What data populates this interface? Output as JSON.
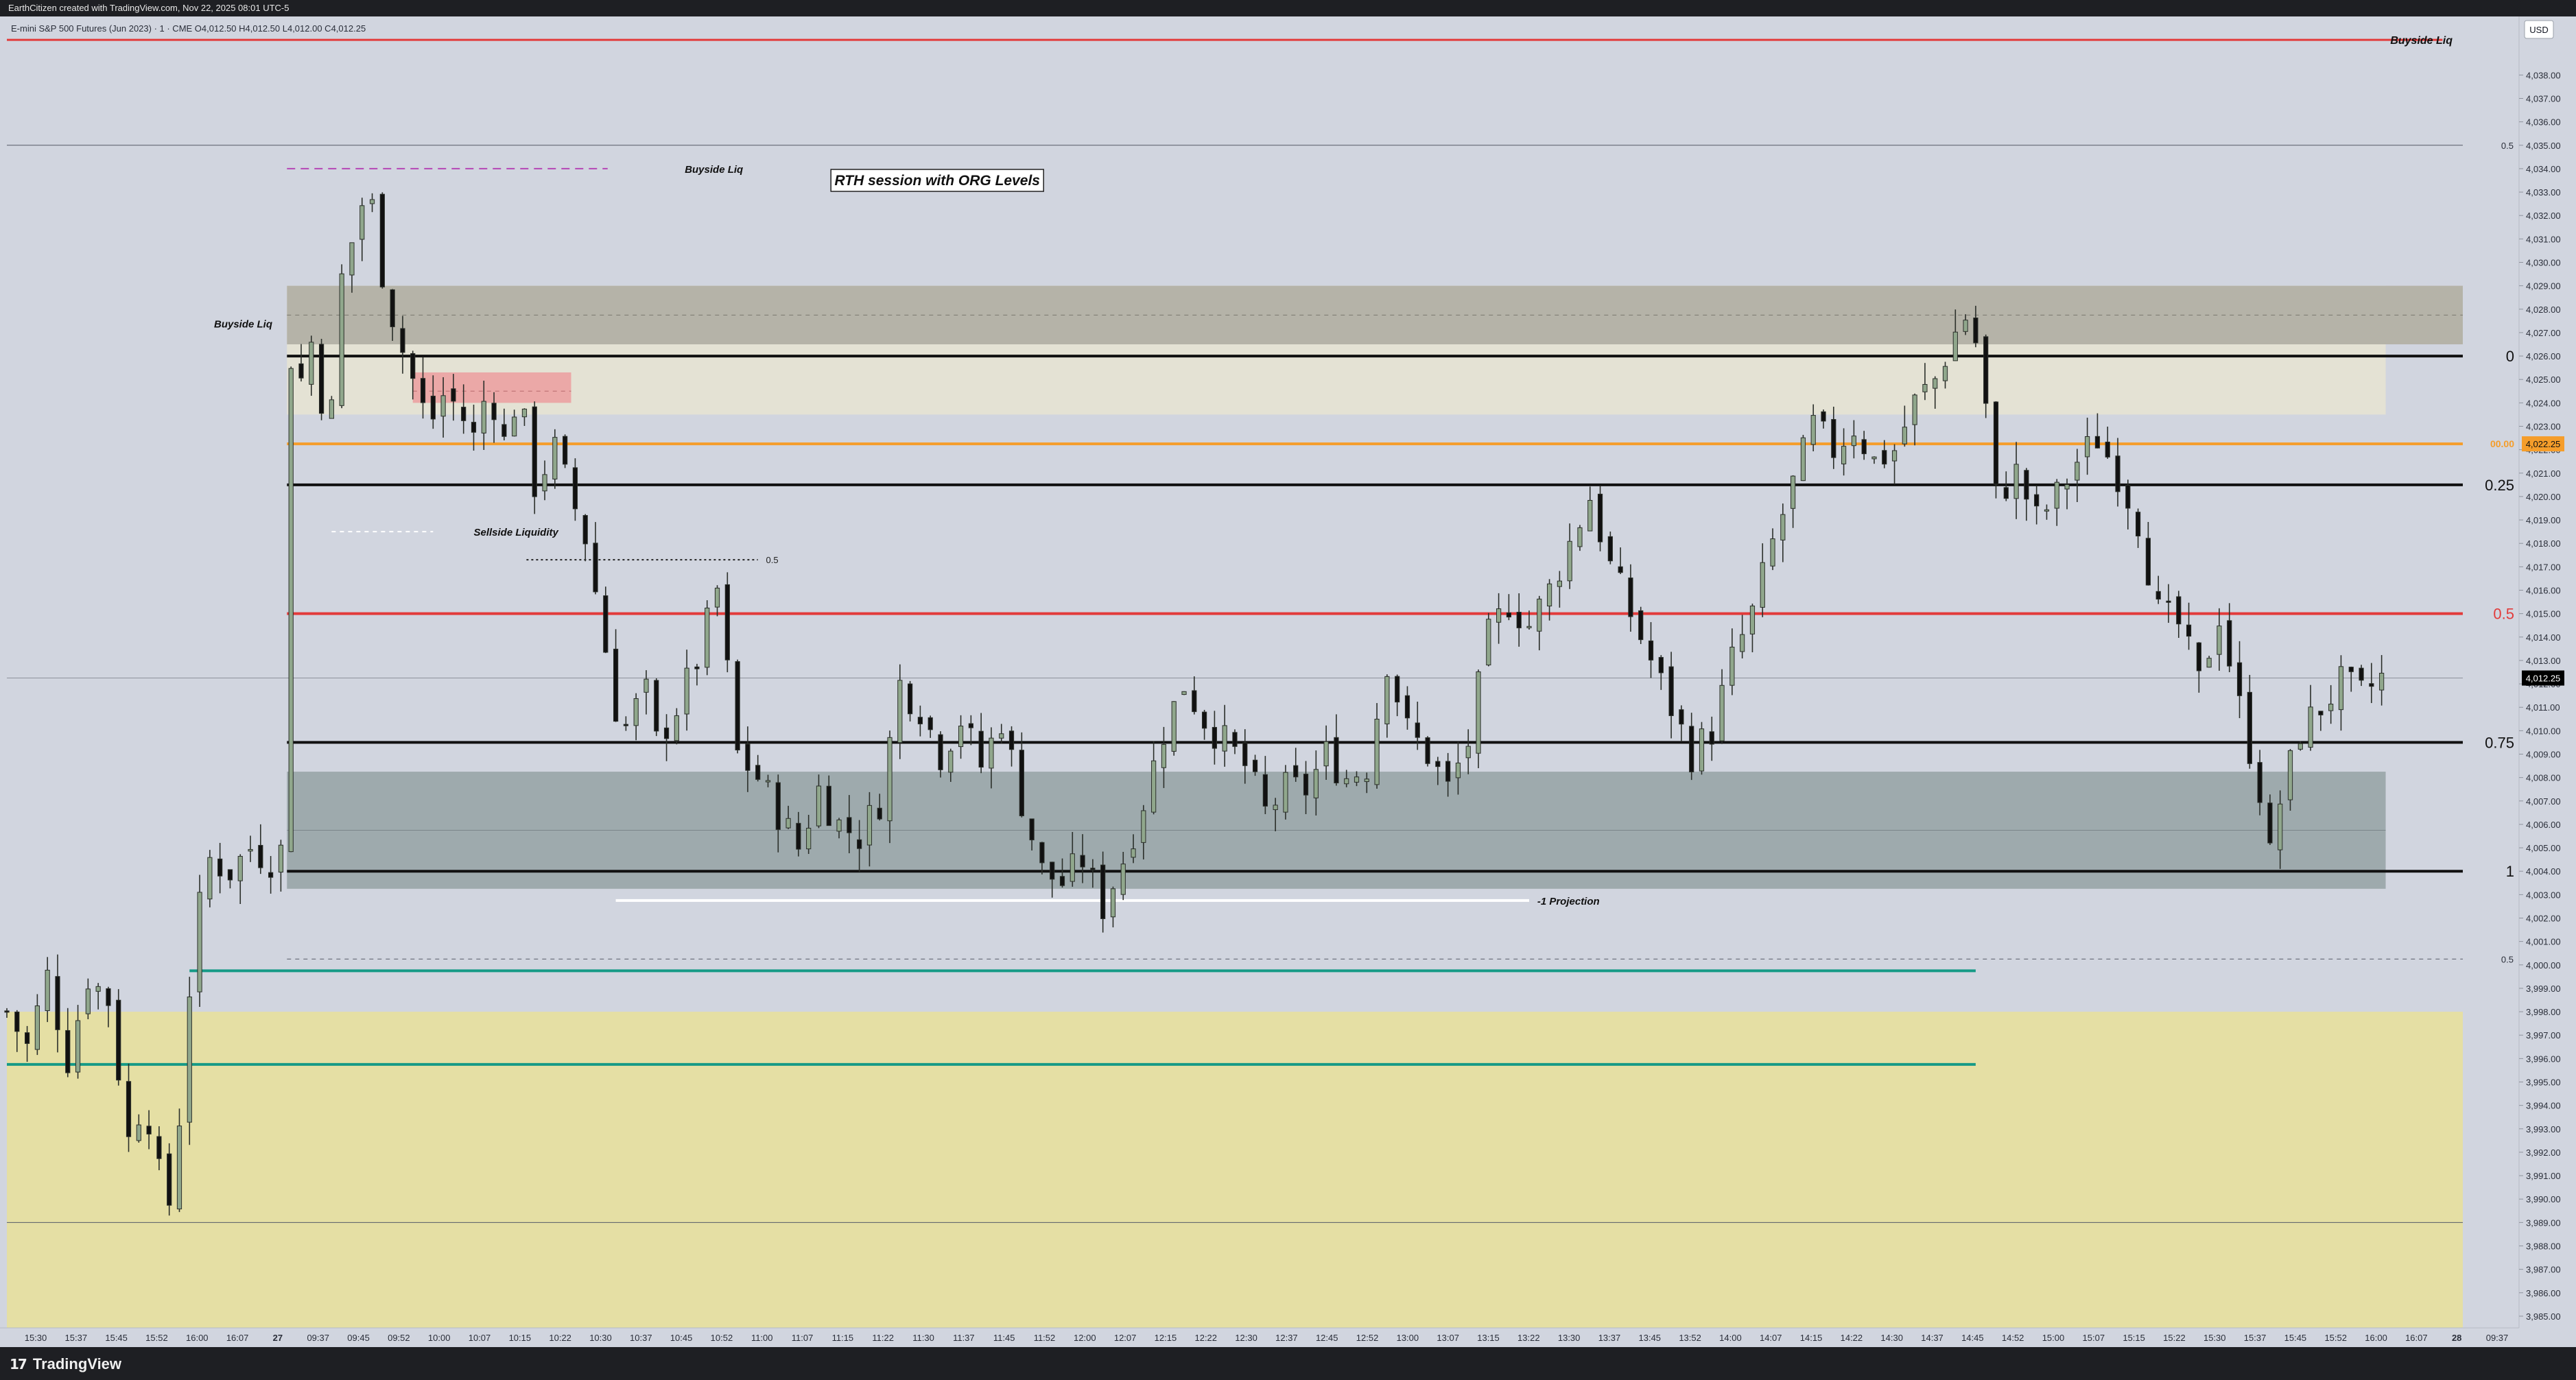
{
  "header": {
    "caption": "EarthCitizen created with TradingView.com, Nov 22, 2025 08:01 UTC-5"
  },
  "footer": {
    "brand": "TradingView",
    "brand_icon": "tradingview-logo-icon"
  },
  "chart_data": {
    "type": "candlestick",
    "symbol_line": "E-mini S&P 500 Futures (Jun 2023) · 1 · CME  O4,012.50  H4,012.50  L4,012.00  C4,012.25",
    "currency": "USD",
    "ylim": [
      3984.5,
      4040.5
    ],
    "y_ticks": [
      "4,038.00",
      "4,037.00",
      "4,036.00",
      "4,035.00",
      "4,034.00",
      "4,033.00",
      "4,032.00",
      "4,031.00",
      "4,030.00",
      "4,029.00",
      "4,028.00",
      "4,027.00",
      "4,026.00",
      "4,025.00",
      "4,024.00",
      "4,023.00",
      "4,022.00",
      "4,021.00",
      "4,020.00",
      "4,019.00",
      "4,018.00",
      "4,017.00",
      "4,016.00",
      "4,015.00",
      "4,014.00",
      "4,013.00",
      "4,012.00",
      "4,011.00",
      "4,010.00",
      "4,009.00",
      "4,008.00",
      "4,007.00",
      "4,006.00",
      "4,005.00",
      "4,004.00",
      "4,003.00",
      "4,002.00",
      "4,001.00",
      "4,000.00",
      "3,999.00",
      "3,998.00",
      "3,997.00",
      "3,996.00",
      "3,995.00",
      "3,994.00",
      "3,993.00",
      "3,992.00",
      "3,991.00",
      "3,990.00",
      "3,989.00",
      "3,988.00",
      "3,987.00",
      "3,986.00",
      "3,985.00"
    ],
    "x_ticks": [
      "15:30",
      "15:37",
      "15:45",
      "15:52",
      "16:00",
      "16:07",
      "27",
      "09:37",
      "09:45",
      "09:52",
      "10:00",
      "10:07",
      "10:15",
      "10:22",
      "10:30",
      "10:37",
      "10:45",
      "10:52",
      "11:00",
      "11:07",
      "11:15",
      "11:22",
      "11:30",
      "11:37",
      "11:45",
      "11:52",
      "12:00",
      "12:07",
      "12:15",
      "12:22",
      "12:30",
      "12:37",
      "12:45",
      "12:52",
      "13:00",
      "13:07",
      "13:15",
      "13:22",
      "13:30",
      "13:37",
      "13:45",
      "13:52",
      "14:00",
      "14:07",
      "14:15",
      "14:22",
      "14:30",
      "14:37",
      "14:45",
      "14:52",
      "15:00",
      "15:07",
      "15:15",
      "15:22",
      "15:30",
      "15:37",
      "15:45",
      "15:52",
      "16:00",
      "16:07",
      "28",
      "09:37"
    ],
    "x_range": [
      0,
      60.5
    ],
    "price_path": [
      [
        0,
        3998
      ],
      [
        0.5,
        3996.5
      ],
      [
        1,
        3999.5
      ],
      [
        1.5,
        3996
      ],
      [
        2,
        3999.5
      ],
      [
        2.5,
        3998.5
      ],
      [
        3,
        3992.5
      ],
      [
        3.4,
        3994.5
      ],
      [
        3.8,
        3990.5
      ],
      [
        4.1,
        3989.5
      ],
      [
        4.4,
        3997.5
      ],
      [
        4.7,
        4002
      ],
      [
        5,
        4004.5
      ],
      [
        5.5,
        4004
      ],
      [
        6,
        4005
      ],
      [
        6.5,
        4004.5
      ],
      [
        6.85,
        4005
      ],
      [
        7,
        4026
      ],
      [
        7.3,
        4024.8
      ],
      [
        7.6,
        4027.5
      ],
      [
        7.9,
        4021
      ],
      [
        8.2,
        4029
      ],
      [
        8.6,
        4031.5
      ],
      [
        8.9,
        4033.5
      ],
      [
        9.2,
        4030
      ],
      [
        9.6,
        4027
      ],
      [
        10,
        4025
      ],
      [
        10.4,
        4023
      ],
      [
        10.8,
        4024.5
      ],
      [
        11.2,
        4023.5
      ],
      [
        11.5,
        4022.5
      ],
      [
        11.9,
        4025
      ],
      [
        12.2,
        4022
      ],
      [
        12.6,
        4024.5
      ],
      [
        13,
        4020.5
      ],
      [
        13.5,
        4022
      ],
      [
        13.9,
        4020
      ],
      [
        14.3,
        4018
      ],
      [
        14.6,
        4015
      ],
      [
        15,
        4011
      ],
      [
        15.3,
        4010
      ],
      [
        15.7,
        4012
      ],
      [
        16,
        4009.5
      ],
      [
        16.5,
        4011
      ],
      [
        17,
        4013
      ],
      [
        17.5,
        4016
      ],
      [
        18,
        4009
      ],
      [
        18.5,
        4008
      ],
      [
        19,
        4006.5
      ],
      [
        19.5,
        4005
      ],
      [
        20,
        4007.5
      ],
      [
        20.5,
        4006
      ],
      [
        21,
        4005.5
      ],
      [
        21.5,
        4007
      ],
      [
        22,
        4012
      ],
      [
        22.5,
        4011
      ],
      [
        23,
        4009
      ],
      [
        23.5,
        4010.5
      ],
      [
        24,
        4008.5
      ],
      [
        24.5,
        4010.5
      ],
      [
        25,
        4007
      ],
      [
        25.5,
        4004
      ],
      [
        26,
        4003.5
      ],
      [
        26.5,
        4004.5
      ],
      [
        27,
        4002.5
      ],
      [
        27.5,
        4004.5
      ],
      [
        28,
        4007
      ],
      [
        28.5,
        4010
      ],
      [
        29,
        4012
      ],
      [
        29.5,
        4010.5
      ],
      [
        30,
        4009.5
      ],
      [
        30.5,
        4008.5
      ],
      [
        31,
        4006.5
      ],
      [
        31.5,
        4007.5
      ],
      [
        32,
        4007.5
      ],
      [
        32.5,
        4009
      ],
      [
        33,
        4008
      ],
      [
        33.5,
        4008.5
      ],
      [
        34,
        4013
      ],
      [
        34.5,
        4010
      ],
      [
        35,
        4009
      ],
      [
        35.5,
        4007.5
      ],
      [
        36,
        4009.5
      ],
      [
        36.5,
        4014
      ],
      [
        37,
        4015.5
      ],
      [
        37.5,
        4014.5
      ],
      [
        38,
        4016
      ],
      [
        38.5,
        4018
      ],
      [
        39,
        4020
      ],
      [
        39.5,
        4017
      ],
      [
        40,
        4015
      ],
      [
        40.5,
        4013
      ],
      [
        41,
        4011
      ],
      [
        41.5,
        4009
      ],
      [
        42,
        4010
      ],
      [
        42.5,
        4013
      ],
      [
        43,
        4015
      ],
      [
        43.5,
        4018
      ],
      [
        44,
        4020.5
      ],
      [
        44.5,
        4023
      ],
      [
        45,
        4022
      ],
      [
        45.5,
        4023
      ],
      [
        46,
        4021.5
      ],
      [
        46.5,
        4022
      ],
      [
        47,
        4024
      ],
      [
        47.5,
        4025
      ],
      [
        48,
        4027
      ],
      [
        48.3,
        4027.8
      ],
      [
        48.6,
        4026
      ],
      [
        49,
        4020
      ],
      [
        49.5,
        4021
      ],
      [
        50,
        4019
      ],
      [
        50.5,
        4020
      ],
      [
        51,
        4021.5
      ],
      [
        51.5,
        4022.5
      ],
      [
        52,
        4021
      ],
      [
        52.5,
        4019
      ],
      [
        53,
        4015
      ],
      [
        53.5,
        4014.5
      ],
      [
        54,
        4012
      ],
      [
        54.5,
        4015
      ],
      [
        55,
        4011
      ],
      [
        55.5,
        4007.5
      ],
      [
        55.8,
        4004
      ],
      [
        56,
        4007
      ],
      [
        56.5,
        4010
      ],
      [
        57,
        4011
      ],
      [
        57.5,
        4012
      ],
      [
        58,
        4011.5
      ],
      [
        58.5,
        4012.25
      ]
    ],
    "levels": [
      {
        "price": 4026.0,
        "label": "0",
        "color": "#111111"
      },
      {
        "price": 4022.25,
        "label": "00.00",
        "color": "#f59d2a"
      },
      {
        "price": 4020.5,
        "label": "0.25",
        "color": "#111111"
      },
      {
        "price": 4015.0,
        "label": "0.5",
        "color": "#e23b3b"
      },
      {
        "price": 4009.5,
        "label": "0.75",
        "color": "#111111"
      },
      {
        "price": 4004.0,
        "label": "1",
        "color": "#111111"
      }
    ],
    "right_labels": [
      {
        "price": 4035.0,
        "label": "0.5"
      },
      {
        "price": 4000.25,
        "label": "0.5"
      }
    ],
    "price_badges": [
      {
        "price": 4022.25,
        "text": "4,022.25",
        "bg": "#f59d2a",
        "fg": "#111111"
      },
      {
        "price": 4012.25,
        "text": "4,012.25",
        "bg": "#000000",
        "fg": "#ffffff"
      }
    ],
    "zones": [
      {
        "name": "premium-zone",
        "top": 4029.0,
        "bottom": 4023.5,
        "color": "#e4e2d4"
      },
      {
        "name": "buyside-block",
        "top": 4029.0,
        "bottom": 4026.5,
        "color": "#b5b3a8"
      },
      {
        "name": "discount-zone",
        "top": 4008.25,
        "bottom": 4003.25,
        "color": "#9eaaad"
      },
      {
        "name": "prior-day-zone",
        "top": 3998.0,
        "bottom": 3984.5,
        "color": "#e5dfa4"
      },
      {
        "name": "order-block",
        "top": 4025.3,
        "bottom": 4024.0,
        "color": "#ec9d9f"
      }
    ],
    "annotations": {
      "title_box": "RTH session with ORG Levels",
      "buyside_liq_top": "Buyside Liq",
      "buyside_liq_1": "Buyside Liq",
      "buyside_liq_2": "Buyside Liq",
      "sellside_liquidity": "Sellside Liquidity",
      "projection": "-1 Projection",
      "mid_half": "0.5"
    },
    "colors": {
      "bull": "#90a78c",
      "bear": "#111111",
      "background": "#d1d5df",
      "red_line": "#e23b3b",
      "teal_line": "#159a86",
      "purple_dash": "#b545b5"
    }
  }
}
